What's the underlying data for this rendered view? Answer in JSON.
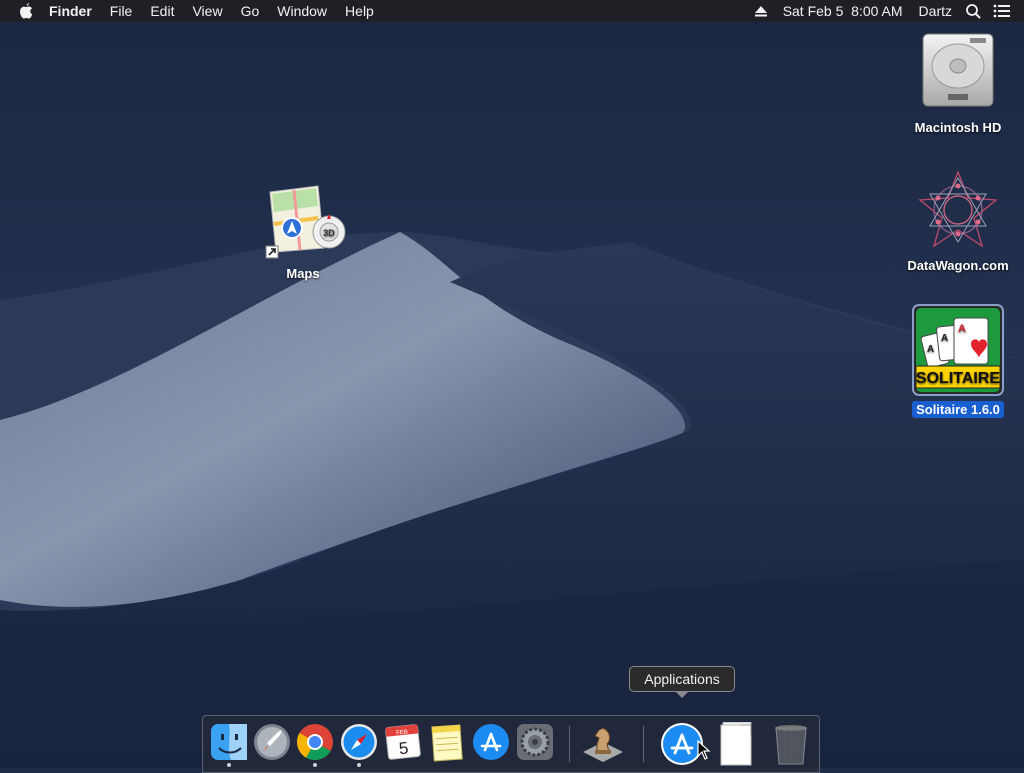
{
  "menubar": {
    "apple": "apple-icon",
    "app_name": "Finder",
    "menus": [
      "File",
      "Edit",
      "View",
      "Go",
      "Window",
      "Help"
    ],
    "datetime": "Sat Feb 5  8:00 AM",
    "user": "Dartz"
  },
  "desktop": {
    "icons": [
      {
        "label": "Macintosh HD",
        "icon": "hard-drive-icon"
      },
      {
        "label": "DataWagon.com",
        "icon": "datawagon-icon"
      },
      {
        "label": "Solitaire 1.6.0",
        "icon": "solitaire-icon",
        "selected": true
      },
      {
        "label": "Maps",
        "icon": "maps-alias-icon"
      }
    ]
  },
  "solitaire_badge": "SOLITAIRE",
  "maps_badge": "3D",
  "tooltip": "Applications",
  "dock": {
    "items": [
      "Finder",
      "Launchpad",
      "Google Chrome",
      "Safari",
      "Calendar",
      "Notes",
      "App Store",
      "System Preferences",
      "Chess",
      "Applications",
      "Documents",
      "Trash"
    ],
    "calendar_month": "FEB",
    "calendar_day": "5"
  },
  "colors": {
    "menubar_bg": "#202024",
    "selection_blue": "#1a5fd0",
    "sky": "#1e2c47",
    "dune": "#4a5874"
  }
}
